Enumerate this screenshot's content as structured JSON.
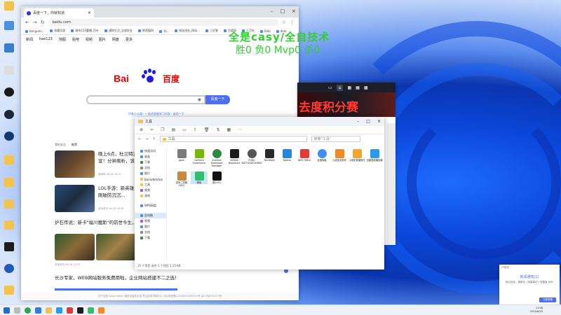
{
  "overlay": {
    "line1": "全是casy/全自技术",
    "line2": "胜0 负0 Mvp0 杀0"
  },
  "browser": {
    "tab_title": "百度一下，你就知道",
    "url": "baidu.com",
    "bookmarks": [
      "bangumi...",
      "收藏页面",
      "城市123重播_百叶",
      "通知生活_全部好友",
      "影视窗网",
      "Yo...",
      "网站排名_网站...",
      "三好客",
      "百度网",
      "人月社",
      "Bilbi",
      "dota"
    ],
    "topnav": [
      "新闻",
      "hao123",
      "地图",
      "贴吧",
      "视频",
      "图片",
      "网盘",
      "更多"
    ],
    "logo_bai": "Bai",
    "logo_du": "百度",
    "search_button": "百度一下",
    "hint": "问卷上公测 · 一站式智能学习问答 · 体验一下",
    "feed_tabs": [
      "我的关注",
      "推荐"
    ],
    "news": [
      {
        "title": "晚上6点，杜兰特正式官宣！分钟离析，该下两年",
        "meta": "新闻网 06-28 18:31"
      },
      {
        "title": "LOL手游：新英雄... 嗣，彬刚破防沉沉...",
        "meta": "游戏资讯 06-28 18:36"
      },
      {
        "title": "炉石传说：新卡\"福川魔斯\"的前世今生，我认为…",
        "meta": "游戏资讯 06-28 22:35"
      },
      {
        "title": "长沙专家，WEB网站服务免费用啦，企业网站搭建不二之选！",
        "meta": ""
      }
    ],
    "footer": "关于百度  About Baidu  使用百度前必读  意见反馈  帮助中心  京公网安备11000002000001号  京ICP证030173号"
  },
  "game": {
    "banner": "去度积分赛"
  },
  "explorer": {
    "title": "工具",
    "path": "工具",
    "search_placeholder": "搜索\"工具\"",
    "sidebar": [
      "快速访问",
      "桌面",
      "下载",
      "文档",
      "图片",
      "BaiduNetdisk",
      "工具",
      "视频",
      "游戏",
      "WPS网盘",
      "此电脑",
      "视频",
      "图片",
      "文档",
      "下载"
    ],
    "files": [
      "geek",
      "GeForce Experience",
      "Internet Download Manager",
      "NVIDIA Broadcast",
      "PUBG BATTLEGROUNDS",
      "TechMark",
      "ToDesk",
      "WPS Office",
      "百度网盘",
      "火绒安全软件",
      "小成影音播放件",
      "迅雷视频播放器",
      "游戏工具箱 2022",
      "微信",
      "图1933"
    ],
    "status": "15 个项目   选中 1 个项目  1.15 KB"
  },
  "notification": {
    "app": "FY助手",
    "title": "新闻通知(1)",
    "body": "现已自动，更新至《传星事记》完整版 DNF",
    "button": "立即查看"
  },
  "taskbar": {
    "time": "11:06",
    "date": "2022/6/29"
  }
}
